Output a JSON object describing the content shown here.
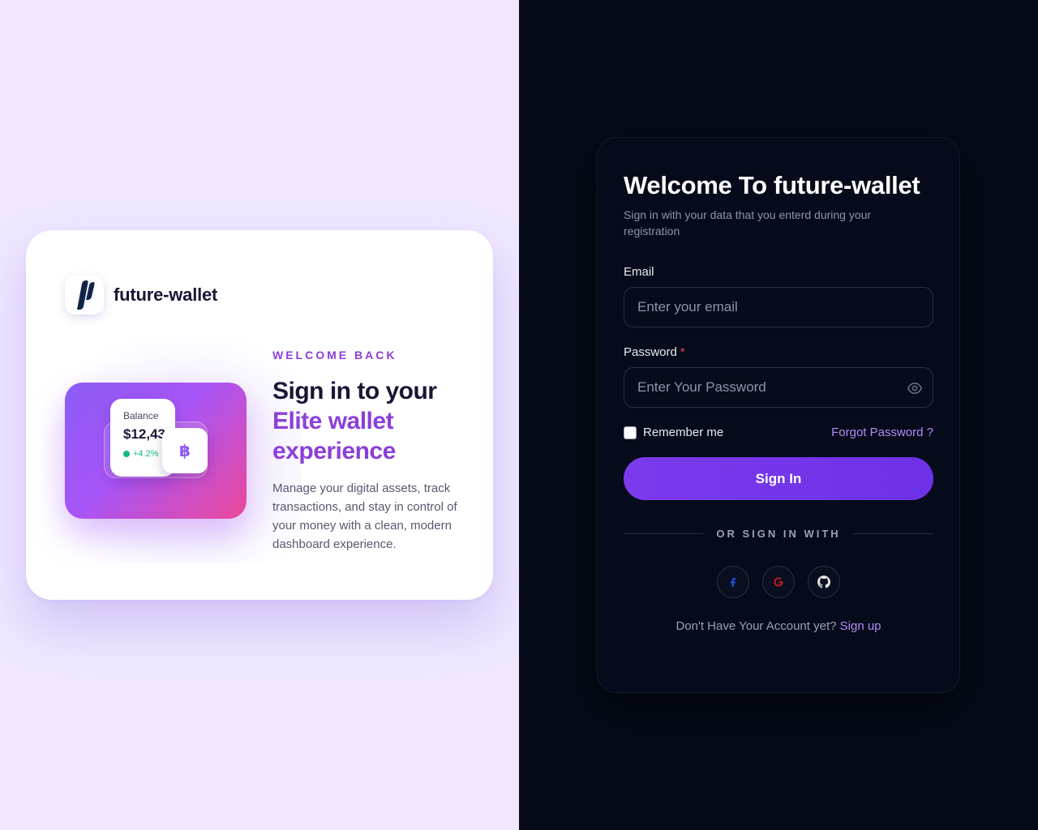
{
  "brand": {
    "name": "future-wallet"
  },
  "promo": {
    "eyebrow": "WELCOME BACK",
    "headline_line1": "Sign in to your",
    "headline_accent": "Elite wallet experience",
    "description": "Manage your digital assets, track transactions, and stay in control of your money with a clean, modern dashboard experience.",
    "balance_label": "Balance",
    "balance_value": "$12,430",
    "balance_change": "+4.2%",
    "crypto_symbol": "฿"
  },
  "login": {
    "title": "Welcome To future-wallet",
    "subtitle": "Sign in with your data that you enterd during your registration",
    "email_label": "Email",
    "email_placeholder": "Enter your email",
    "password_label": "Password",
    "password_required": "*",
    "password_placeholder": "Enter Your Password",
    "remember_label": "Remember me",
    "forgot_label": "Forgot Password ?",
    "submit_label": "Sign In",
    "divider_text": "OR SIGN IN WITH",
    "socials": [
      "facebook-icon",
      "google-icon",
      "github-icon"
    ],
    "footer_text": "Don't Have Your Account yet?",
    "signup_label": "Sign up"
  },
  "colors": {
    "accent": "#7c3aed",
    "accent_text": "#8b3fd9",
    "link": "#b48af5",
    "left_bg": "#f0e7ff",
    "right_bg": "#050a18",
    "positive": "#10b981",
    "required": "#ef4444"
  }
}
